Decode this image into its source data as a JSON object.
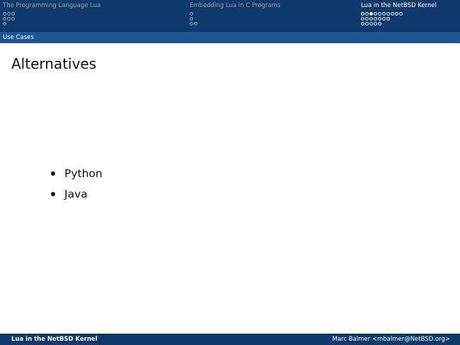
{
  "nav": {
    "sections": [
      {
        "title": "The Programming Language Lua",
        "active": false,
        "subsections": [
          {
            "frames": 3,
            "current": -1
          },
          {
            "frames": 3,
            "current": -1
          },
          {
            "frames": 1,
            "current": -1
          }
        ]
      },
      {
        "title": "Embedding Lua in C Programs",
        "active": false,
        "subsections": [
          {
            "frames": 1,
            "current": -1
          },
          {
            "frames": 1,
            "current": -1
          },
          {
            "frames": 2,
            "current": -1
          }
        ]
      },
      {
        "title": "Lua in the NetBSD Kernel",
        "active": true,
        "subsections": [
          {
            "frames": 10,
            "current": 2
          },
          {
            "frames": 7,
            "current": -1
          },
          {
            "frames": 5,
            "current": -1
          }
        ]
      }
    ]
  },
  "subsection": {
    "title": "Use Cases"
  },
  "frame": {
    "title": "Alternatives",
    "bullets": [
      "Python",
      "Java"
    ]
  },
  "footer": {
    "left": "Lua in the NetBSD Kernel",
    "right": "Marc Balmer <mbalmer@NetBSD.org>"
  },
  "colors": {
    "header_dark": "#0e3a6b",
    "header_light": "#1d5494",
    "inactive_text": "#8c9fb9",
    "active_text": "#ffffff"
  }
}
